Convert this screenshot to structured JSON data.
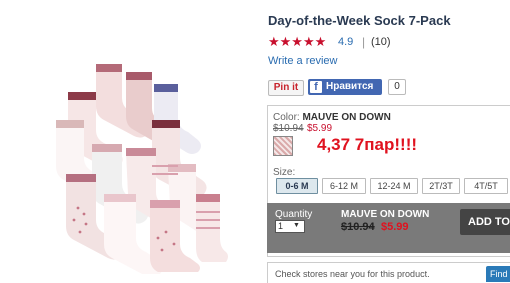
{
  "product": {
    "title": "Day-of-the-Week Sock 7-Pack",
    "stars": "★★★★★",
    "rating": "4.9",
    "separator": "|",
    "review_count": "(10)",
    "write_review": "Write a review"
  },
  "social": {
    "pinit": "Pin it",
    "fb_logo": "f",
    "fb_label": "Нравится",
    "fb_count": "0"
  },
  "options": {
    "color_prefix": "Color:",
    "color_name": "MAUVE ON DOWN",
    "price_old": "$10.94",
    "price_new": "$5.99",
    "annotation": "4,37 7пар!!!!",
    "size_label": "Size:",
    "sizes": [
      "0-6 M",
      "6-12 M",
      "12-24 M",
      "2T/3T",
      "4T/5T"
    ],
    "selected_size": "0-6 M"
  },
  "bag_bar": {
    "qty_label": "Quantity",
    "qty_value": "1",
    "color_name": "MAUVE ON DOWN",
    "price_old": "$10.94",
    "price_new": "$5.99",
    "add_label": "ADD TO BAG"
  },
  "stores": {
    "text": "Check stores near you for this product.",
    "button": "Find"
  },
  "colors": {
    "accent_red": "#c8102e",
    "link_blue": "#2a6cb0",
    "bar_gray": "#7a7a7a"
  }
}
